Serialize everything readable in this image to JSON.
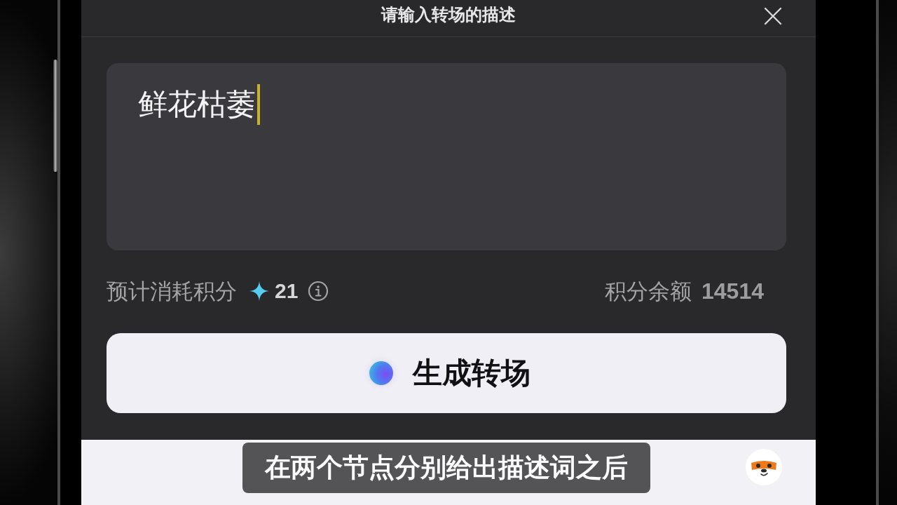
{
  "dialog": {
    "title": "请输入转场的描述"
  },
  "description_field": {
    "value": "鲜花枯萎",
    "focused": true
  },
  "cost": {
    "label": "预计消耗积分",
    "value": "21"
  },
  "balance": {
    "label": "积分余额",
    "value": "14514"
  },
  "generate_button": {
    "label": "生成转场"
  },
  "caption": {
    "text": "在两个节点分别给出描述词之后"
  }
}
